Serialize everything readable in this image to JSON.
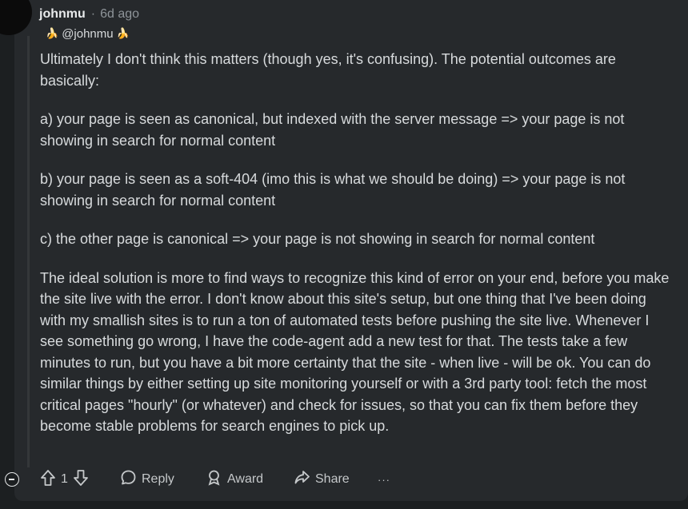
{
  "comment": {
    "author": "johnmu",
    "separator": "·",
    "time": "6d ago",
    "flair": {
      "emoji_left": "🍌",
      "text": "@johnmu",
      "emoji_right": "🍌"
    },
    "paragraphs": [
      "Ultimately I don't think this matters (though yes, it's confusing). The potential outcomes are basically:",
      "a) your page is seen as canonical, but indexed with the server message => your page is not showing in search for normal content",
      "b) your page is seen as a soft-404 (imo this is what we should be doing) => your page is not showing in search for normal content",
      "c) the other page is canonical => your page is not showing in search for normal content",
      "The ideal solution is more to find ways to recognize this kind of error on your end, before you make the site live with the error. I don't know about this site's setup, but one thing that I've been doing with my smallish sites is to run a ton of automated tests before pushing the site live. Whenever I see something go wrong, I have the code-agent add a new test for that. The tests take a few minutes to run, but you have a bit more certainty that the site - when live - will be ok. You can do similar things by either setting up site monitoring yourself or with a 3rd party tool: fetch the most critical pages \"hourly\" (or whatever) and check for issues, so that you can fix them before they become stable problems for search engines to pick up."
    ]
  },
  "actions": {
    "vote_count": "1",
    "reply_label": "Reply",
    "award_label": "Award",
    "share_label": "Share",
    "more_label": "···"
  }
}
